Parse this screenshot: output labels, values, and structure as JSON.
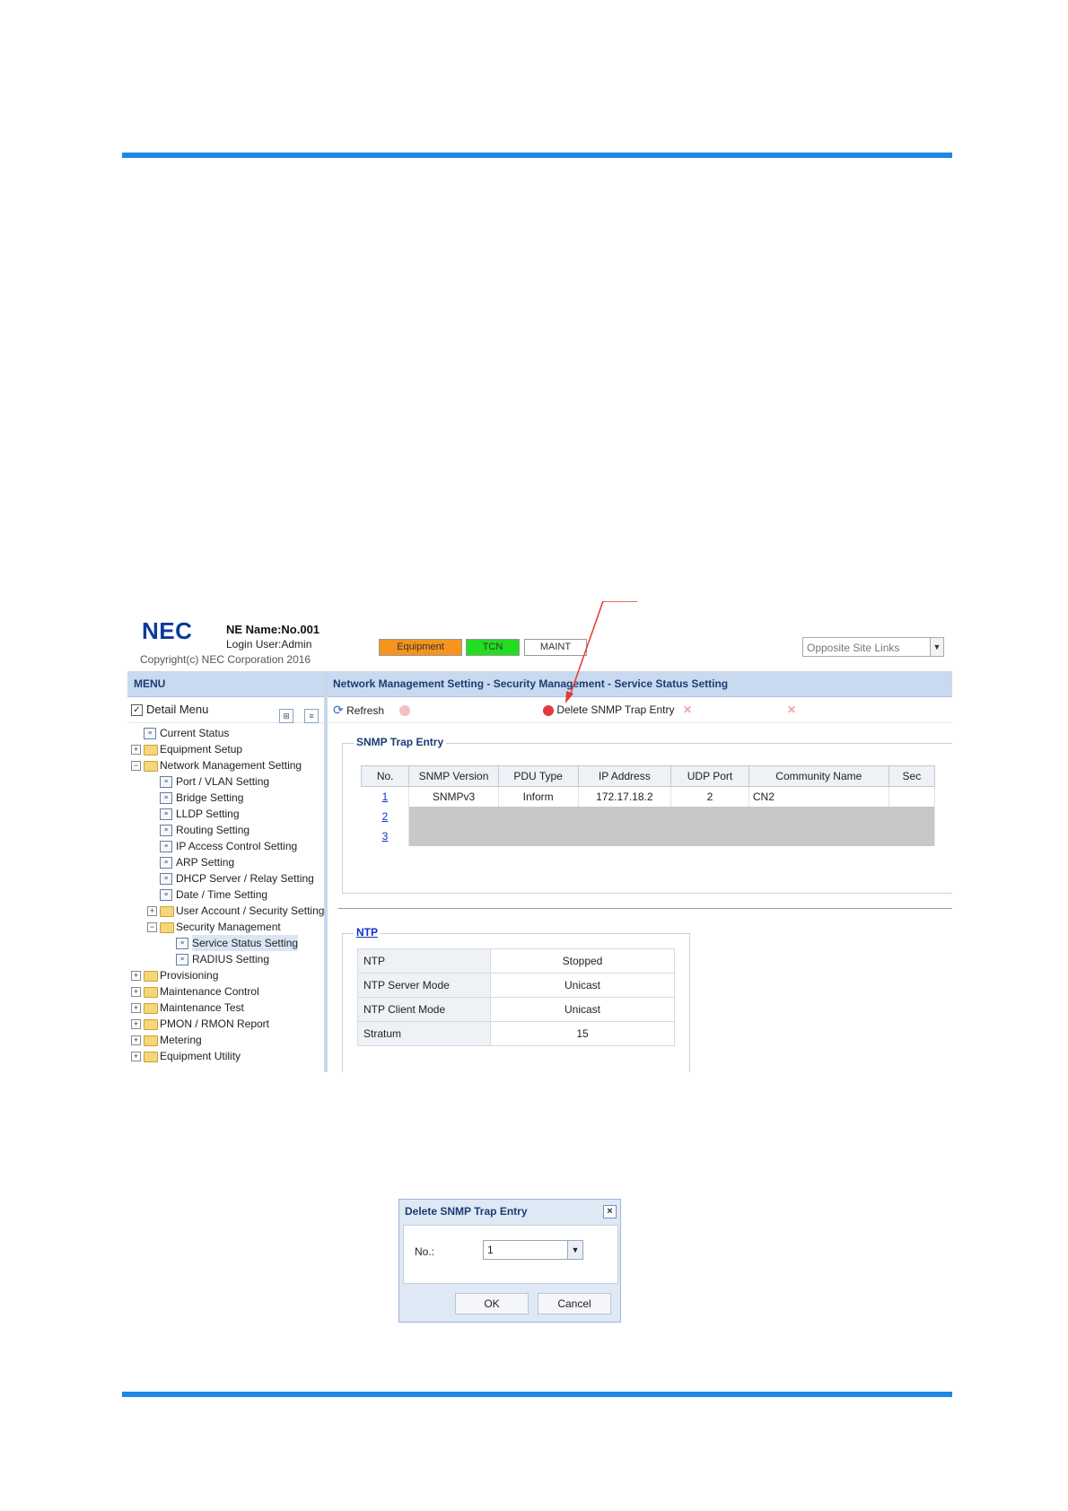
{
  "header": {
    "logo": "NEC",
    "ne_name": "NE Name:No.001",
    "login_user": "Login User:Admin",
    "copyright": "Copyright(c) NEC Corporation 2016",
    "status_buttons": [
      {
        "label": "Equipment",
        "color": "#f7941d"
      },
      {
        "label": "TCN",
        "color": "#22dd22"
      },
      {
        "label": "MAINT",
        "color": "#ffffff"
      }
    ],
    "site_select": "Opposite Site Links"
  },
  "menu": {
    "title": "MENU",
    "detail_menu_label": "Detail Menu",
    "detail_menu_checked": "✓",
    "tree": [
      {
        "label": "Current Status",
        "icon": "page-icon",
        "level": 0
      },
      {
        "label": "Equipment Setup",
        "icon": "folder-icon",
        "level": 0,
        "toggle": "+"
      },
      {
        "label": "Network Management Setting",
        "icon": "folder-icon",
        "level": 0,
        "toggle": "-"
      },
      {
        "label": "Port / VLAN Setting",
        "icon": "page-icon",
        "level": 1
      },
      {
        "label": "Bridge Setting",
        "icon": "page-icon",
        "level": 1
      },
      {
        "label": "LLDP Setting",
        "icon": "page-icon",
        "level": 1
      },
      {
        "label": "Routing Setting",
        "icon": "page-icon",
        "level": 1
      },
      {
        "label": "IP Access Control Setting",
        "icon": "page-icon",
        "level": 1
      },
      {
        "label": "ARP Setting",
        "icon": "page-icon",
        "level": 1
      },
      {
        "label": "DHCP Server / Relay Setting",
        "icon": "page-icon",
        "level": 1
      },
      {
        "label": "Date / Time Setting",
        "icon": "page-icon",
        "level": 1
      },
      {
        "label": "User Account / Security Setting",
        "icon": "folder-icon",
        "level": 1,
        "toggle": "+"
      },
      {
        "label": "Security Management",
        "icon": "folder-icon",
        "level": 1,
        "toggle": "-"
      },
      {
        "label": "Service Status Setting",
        "icon": "page-icon",
        "level": 2,
        "selected": true
      },
      {
        "label": "RADIUS Setting",
        "icon": "page-icon",
        "level": 2
      },
      {
        "label": "Provisioning",
        "icon": "folder-icon",
        "level": 0,
        "toggle": "+"
      },
      {
        "label": "Maintenance Control",
        "icon": "folder-icon",
        "level": 0,
        "toggle": "+"
      },
      {
        "label": "Maintenance Test",
        "icon": "folder-icon",
        "level": 0,
        "toggle": "+"
      },
      {
        "label": "PMON / RMON Report",
        "icon": "folder-icon",
        "level": 0,
        "toggle": "+"
      },
      {
        "label": "Metering",
        "icon": "folder-icon",
        "level": 0,
        "toggle": "+"
      },
      {
        "label": "Equipment Utility",
        "icon": "folder-icon",
        "level": 0,
        "toggle": "+"
      }
    ]
  },
  "content": {
    "breadcrumb": "Network Management Setting - Security Management - Service Status Setting",
    "toolbar": {
      "refresh": "Refresh",
      "delete_trap": "Delete SNMP Trap Entry"
    },
    "snmp_trap": {
      "legend": "SNMP Trap Entry",
      "columns": [
        "No.",
        "SNMP Version",
        "PDU Type",
        "IP Address",
        "UDP Port",
        "Community Name",
        "Sec"
      ],
      "rows": [
        {
          "no": "1",
          "version": "SNMPv3",
          "pdu": "Inform",
          "ip": "172.17.18.2",
          "port": "2",
          "community": "CN2"
        },
        {
          "no": "2"
        },
        {
          "no": "3"
        }
      ]
    },
    "ntp": {
      "legend": "NTP",
      "rows": [
        {
          "key": "NTP",
          "value": "Stopped"
        },
        {
          "key": "NTP Server Mode",
          "value": "Unicast"
        },
        {
          "key": "NTP Client Mode",
          "value": "Unicast"
        },
        {
          "key": "Stratum",
          "value": "15"
        }
      ]
    }
  },
  "dialog": {
    "title": "Delete SNMP Trap Entry",
    "close": "×",
    "field_label": "No.:",
    "field_value": "1",
    "ok": "OK",
    "cancel": "Cancel"
  },
  "colors": {
    "accent_rule": "#1e88e5",
    "annotation_arrow": "#e53935"
  }
}
